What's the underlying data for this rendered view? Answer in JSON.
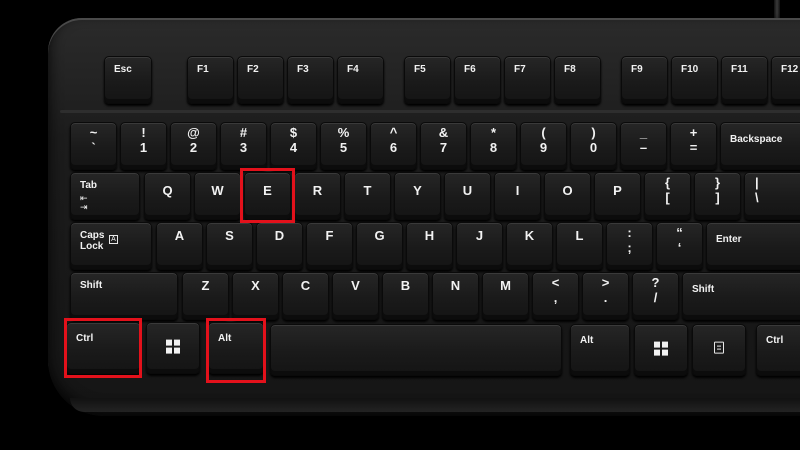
{
  "keyboard": {
    "colors": {
      "body": "#1c1c1c",
      "key": "#1a1a1a",
      "legend": "#f2f2f2",
      "highlight": "#e3111b"
    },
    "keys": {
      "esc": "Esc",
      "f1": "F1",
      "f2": "F2",
      "f3": "F3",
      "f4": "F4",
      "f5": "F5",
      "f6": "F6",
      "f7": "F7",
      "f8": "F8",
      "f9": "F9",
      "f10": "F10",
      "f11": "F11",
      "f12": "F12",
      "tilde": {
        "top": "~",
        "bottom": "`"
      },
      "k1": {
        "top": "!",
        "bottom": "1"
      },
      "k2": {
        "top": "@",
        "bottom": "2"
      },
      "k3": {
        "top": "#",
        "bottom": "3"
      },
      "k4": {
        "top": "$",
        "bottom": "4"
      },
      "k5": {
        "top": "%",
        "bottom": "5"
      },
      "k6": {
        "top": "^",
        "bottom": "6"
      },
      "k7": {
        "top": "&",
        "bottom": "7"
      },
      "k8": {
        "top": "*",
        "bottom": "8"
      },
      "k9": {
        "top": "(",
        "bottom": "9"
      },
      "k0": {
        "top": ")",
        "bottom": "0"
      },
      "minus": {
        "top": "_",
        "bottom": "–"
      },
      "equals": {
        "top": "+",
        "bottom": "="
      },
      "backspace": "Backspace",
      "tab": "Tab",
      "q": "Q",
      "w": "W",
      "e": "E",
      "r": "R",
      "t": "T",
      "y": "Y",
      "u": "U",
      "i": "I",
      "o": "O",
      "p": "P",
      "lbracket": {
        "top": "{",
        "bottom": "["
      },
      "rbracket": {
        "top": "}",
        "bottom": "]"
      },
      "backslash": {
        "top": "|",
        "bottom": "\\"
      },
      "caps": {
        "line1": "Caps",
        "line2": "Lock",
        "box": "A"
      },
      "a": "A",
      "s": "S",
      "d": "D",
      "f": "F",
      "g": "G",
      "h": "H",
      "j": "J",
      "k": "K",
      "l": "L",
      "semicolon": {
        "top": ":",
        "bottom": ";"
      },
      "quote": {
        "top": "“",
        "bottom": "‘"
      },
      "enter": "Enter",
      "shift_left": "Shift",
      "z": "Z",
      "x": "X",
      "c": "C",
      "v": "V",
      "b": "B",
      "n": "N",
      "m": "M",
      "comma": {
        "top": "<",
        "bottom": ","
      },
      "period": {
        "top": ">",
        "bottom": "."
      },
      "slash": {
        "top": "?",
        "bottom": "/"
      },
      "shift_right": "Shift",
      "ctrl_left": "Ctrl",
      "alt_left": "Alt",
      "alt_right": "Alt",
      "ctrl_right": "Ctrl"
    },
    "highlighted_keys": [
      "Ctrl",
      "Alt",
      "E"
    ]
  }
}
